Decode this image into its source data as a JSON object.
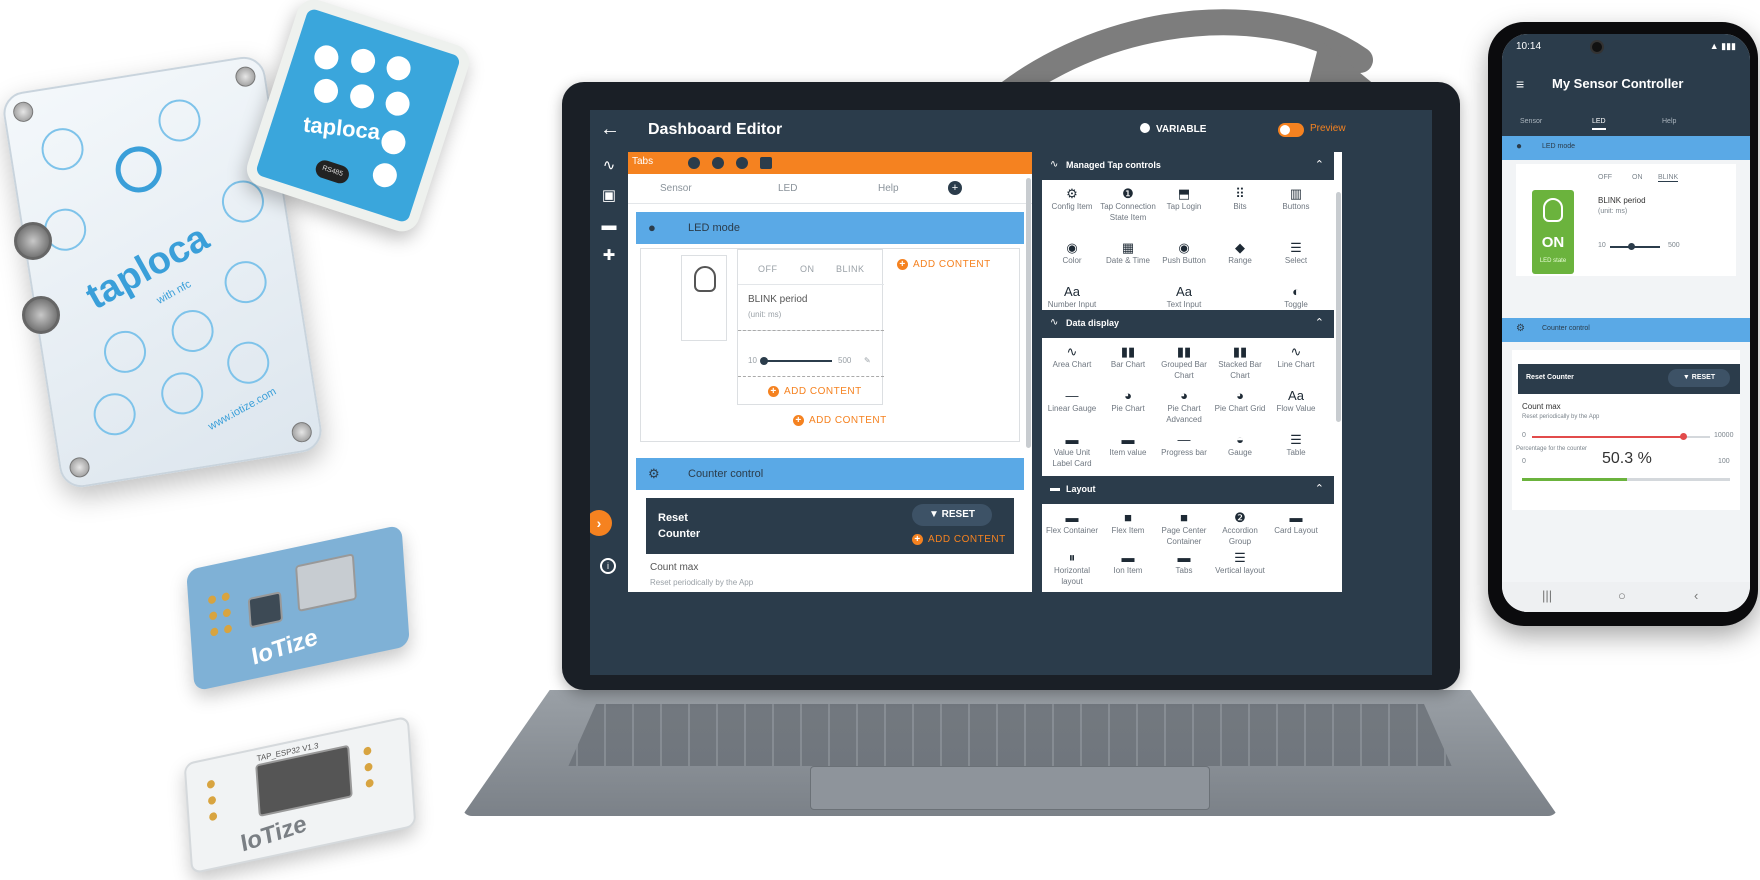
{
  "laptop_app": {
    "title": "Dashboard Editor",
    "variable_label": "VARIABLE",
    "preview_label": "Preview",
    "tabs_label": "Tabs",
    "tabs": [
      {
        "label": "Sensor",
        "icon": "chart-line-icon"
      },
      {
        "label": "LED",
        "icon": "led-icon"
      },
      {
        "label": "Help",
        "icon": "help-icon"
      }
    ],
    "led_section": {
      "title": "LED mode",
      "segments": [
        "OFF",
        "ON",
        "BLINK"
      ],
      "blink_period_label": "BLINK period",
      "blink_period_unit": "(unit: ms)",
      "slider_min": "10",
      "slider_max": "500",
      "add_content": "ADD CONTENT"
    },
    "counter_section": {
      "title": "Counter control",
      "reset_counter_label": "Reset\nCounter",
      "reset_button": "▼ RESET",
      "count_max_label": "Count max",
      "count_max_desc": "Reset periodically by the App"
    },
    "managed_controls": {
      "title": "Managed Tap controls",
      "items": [
        {
          "glyph": "⚙",
          "label": "Config Item"
        },
        {
          "glyph": "❶",
          "label": "Tap Connection State Item"
        },
        {
          "glyph": "⬒",
          "label": "Tap Login"
        },
        {
          "glyph": "⠿",
          "label": "Bits"
        },
        {
          "glyph": "▥",
          "label": "Buttons"
        },
        {
          "glyph": "◉",
          "label": "Color"
        },
        {
          "glyph": "▦",
          "label": "Date & Time"
        },
        {
          "glyph": "◉",
          "label": "Push Button"
        },
        {
          "glyph": "◆",
          "label": "Range"
        },
        {
          "glyph": "☰",
          "label": "Select"
        },
        {
          "glyph": "Aa",
          "label": "Number Input"
        },
        {
          "glyph": "Aa",
          "label": "Text Input"
        },
        {
          "glyph": "◐",
          "label": "Toggle"
        }
      ]
    },
    "data_display": {
      "title": "Data display",
      "items": [
        {
          "glyph": "∿",
          "label": "Area Chart"
        },
        {
          "glyph": "▮▮",
          "label": "Bar Chart"
        },
        {
          "glyph": "▮▮",
          "label": "Grouped Bar Chart"
        },
        {
          "glyph": "▮▮",
          "label": "Stacked Bar Chart"
        },
        {
          "glyph": "∿",
          "label": "Line Chart"
        },
        {
          "glyph": "—",
          "label": "Linear Gauge"
        },
        {
          "glyph": "◕",
          "label": "Pie Chart"
        },
        {
          "glyph": "◕",
          "label": "Pie Chart Advanced"
        },
        {
          "glyph": "◕",
          "label": "Pie Chart Grid"
        },
        {
          "glyph": "Aa",
          "label": "Flow Value"
        },
        {
          "glyph": "▬",
          "label": "Value Unit Label Card"
        },
        {
          "glyph": "▬",
          "label": "Item value"
        },
        {
          "glyph": "—",
          "label": "Progress bar"
        },
        {
          "glyph": "◒",
          "label": "Gauge"
        },
        {
          "glyph": "☰",
          "label": "Table"
        }
      ]
    },
    "layout": {
      "title": "Layout",
      "items": [
        {
          "glyph": "▬",
          "label": "Flex Container"
        },
        {
          "glyph": "■",
          "label": "Flex Item"
        },
        {
          "glyph": "■",
          "label": "Page Center Container"
        },
        {
          "glyph": "❷",
          "label": "Accordion Group"
        },
        {
          "glyph": "▬",
          "label": "Card Layout"
        },
        {
          "glyph": "⏸",
          "label": "Horizontal layout"
        },
        {
          "glyph": "▬",
          "label": "Ion Item"
        },
        {
          "glyph": "▬",
          "label": "Tabs"
        },
        {
          "glyph": "☰",
          "label": "Vertical layout"
        }
      ]
    }
  },
  "phone_app": {
    "time": "10:14",
    "title": "My Sensor Controller",
    "tabs": [
      "Sensor",
      "LED",
      "Help"
    ],
    "led_section": "LED mode",
    "segments": [
      "OFF",
      "ON",
      "BLINK"
    ],
    "led_value": "ON",
    "led_state_label": "LED state",
    "blink_period_label": "BLINK period",
    "blink_period_unit": "(unit: ms)",
    "slider_min": "10",
    "slider_max": "500",
    "counter_section": "Counter control",
    "reset_counter_label": "Reset Counter",
    "reset_button": "▼ RESET",
    "count_max_label": "Count max",
    "count_max_desc": "Reset periodically by the App",
    "count_min": "0",
    "count_max": "10000",
    "count_level": 0.85,
    "percentage_label": "Percentage for the counter",
    "percentage_value": "50.3 %",
    "percentage_min": "0",
    "percentage_max": "100",
    "percentage_level": 0.503
  },
  "devices": {
    "enclosure_brand": "taploca",
    "enclosure_subtitle": "with nfc",
    "enclosure_url": "www.iotize.com",
    "board_brand": "IoTize",
    "blue_box_port": "RS485",
    "board_codes": [
      "TAP_ESP32 V1.3"
    ]
  },
  "colors": {
    "dark_navy": "#2b3c4b",
    "accent_orange": "#f58220",
    "section_blue": "#5aa9e6",
    "led_green": "#6bb33d"
  }
}
